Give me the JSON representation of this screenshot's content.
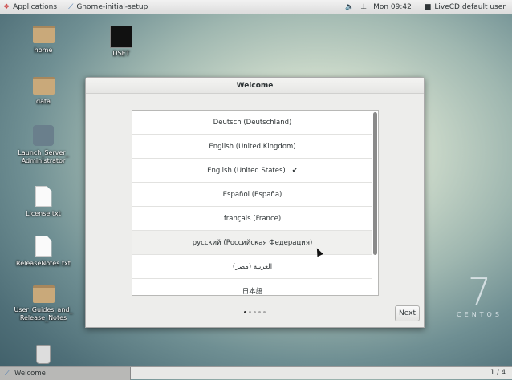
{
  "topbar": {
    "applications": "Applications",
    "app_name": "Gnome-initial-setup",
    "clock": "Mon 09:42",
    "user": "LiveCD default user"
  },
  "desktop": {
    "icons": [
      {
        "label": "home"
      },
      {
        "label": "DSET"
      },
      {
        "label": "data"
      },
      {
        "label": "Launch_Server_ Administrator"
      },
      {
        "label": "License.txt"
      },
      {
        "label": "ReleaseNotes.txt"
      },
      {
        "label": "User_Guides_and_ Release_Notes"
      }
    ],
    "branding": {
      "version": "7",
      "name": "CENTOS"
    }
  },
  "window": {
    "title": "Welcome",
    "languages": [
      {
        "label": "Deutsch (Deutschland)"
      },
      {
        "label": "English (United Kingdom)"
      },
      {
        "label": "English (United States)",
        "selected": true,
        "check": "✔"
      },
      {
        "label": "Español (España)"
      },
      {
        "label": "français (France)"
      },
      {
        "label": "русский (Российская Федерация)"
      },
      {
        "label": "العربية (مصر)"
      },
      {
        "label": "日本語"
      }
    ],
    "page_dots": 5,
    "current_page": 1,
    "next_label": "Next"
  },
  "taskbar": {
    "task": "Welcome",
    "workspace": "1 / 4"
  }
}
